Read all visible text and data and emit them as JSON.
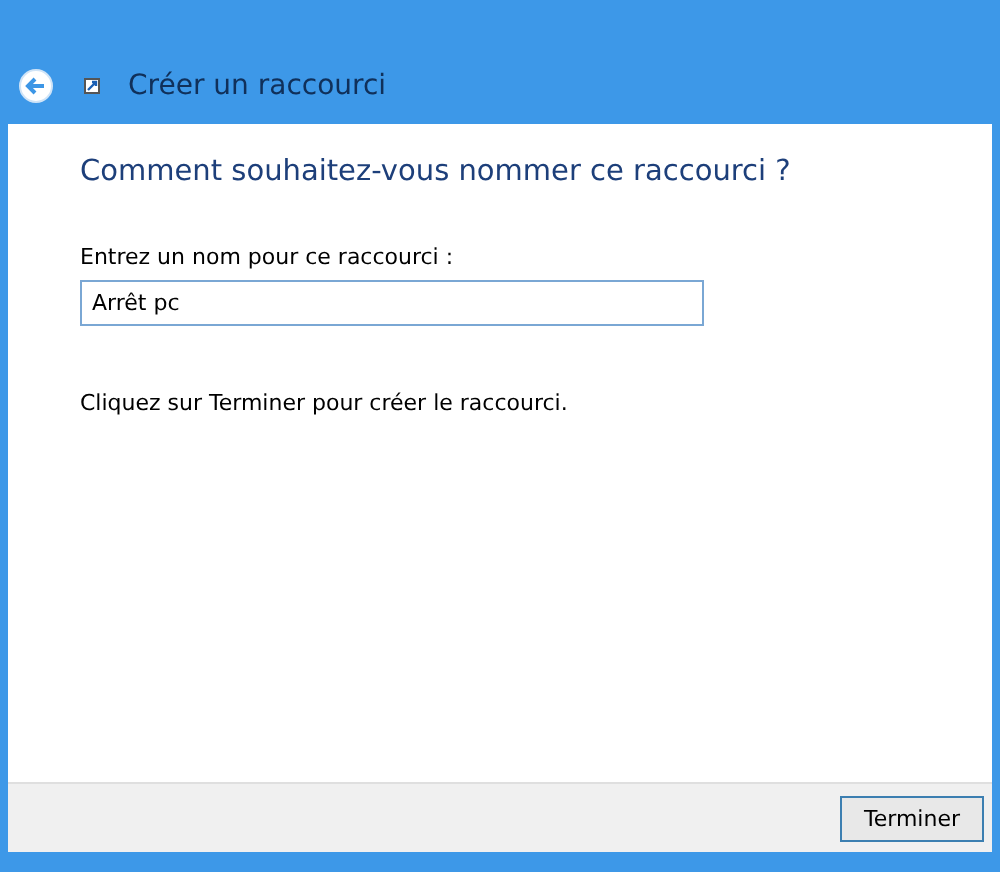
{
  "window": {
    "title": "Créer un raccourci"
  },
  "heading": "Comment souhaitez-vous nommer ce raccourci ?",
  "name_field": {
    "label": "Entrez un nom pour ce raccourci :",
    "value": "Arrêt pc"
  },
  "instruction": "Cliquez sur Terminer pour créer le raccourci.",
  "buttons": [
    "Terminer"
  ]
}
